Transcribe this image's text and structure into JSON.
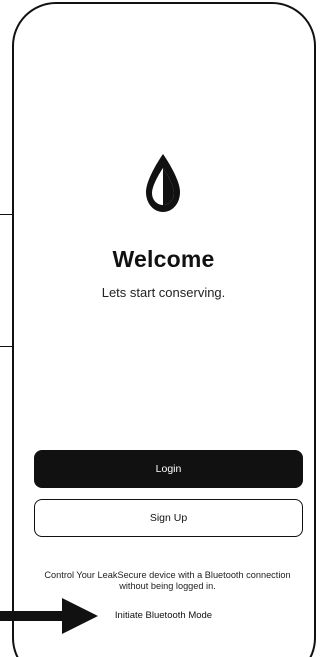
{
  "welcome": {
    "title": "Welcome",
    "subtitle": "Lets start conserving."
  },
  "buttons": {
    "login_label": "Login",
    "signup_label": "Sign Up"
  },
  "bluetooth": {
    "description": "Control Your LeakSecure device with a Bluetooth connection without being logged in.",
    "link_label": "Initiate Bluetooth Mode"
  },
  "colors": {
    "primary": "#111111",
    "background": "#ffffff"
  },
  "icons": {
    "logo": "water-drop-logo-icon",
    "annotation": "arrow-right-icon"
  }
}
